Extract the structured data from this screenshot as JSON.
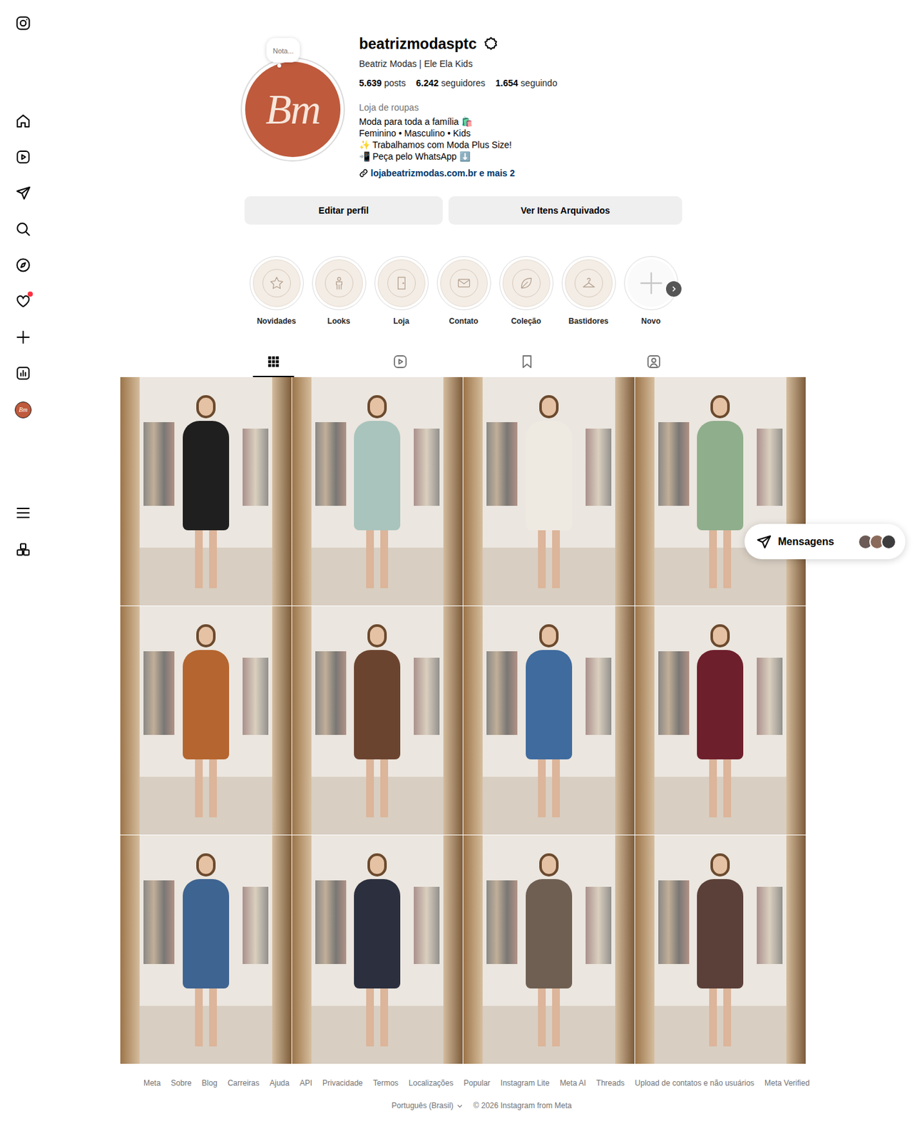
{
  "sidebar": {
    "notifications_dot": true,
    "avatar_text": "Bm"
  },
  "profile": {
    "username": "beatrizmodasptc",
    "full_name": "Beatriz Modas | Ele Ela Kids",
    "note": "Nota...",
    "avatar_text": "Bm",
    "stats": [
      {
        "value": "5.639",
        "label": "posts"
      },
      {
        "value": "6.242",
        "label": "seguidores"
      },
      {
        "value": "1.654",
        "label": "seguindo"
      }
    ],
    "category": "Loja de roupas",
    "bio": [
      "Moda para toda a família 🛍️",
      "Feminino • Masculino • Kids",
      "✨ Trabalhamos com Moda Plus Size!",
      "📲 Peça pelo WhatsApp ⬇️"
    ],
    "link": "lojabeatrizmodas.com.br e mais 2"
  },
  "buttons": [
    {
      "label": "Editar perfil"
    },
    {
      "label": "Ver Itens Arquivados"
    }
  ],
  "highlights": [
    {
      "label": "Novidades",
      "kind": "star"
    },
    {
      "label": "Looks",
      "kind": "figure"
    },
    {
      "label": "Loja",
      "kind": "door"
    },
    {
      "label": "Contato",
      "kind": "mail"
    },
    {
      "label": "Coleção",
      "kind": "leaf"
    },
    {
      "label": "Bastidores",
      "kind": "hanger"
    },
    {
      "label": "Novo",
      "kind": "new"
    }
  ],
  "tabs": [
    {
      "kind": "posts",
      "selected": true
    },
    {
      "kind": "reels",
      "selected": false
    },
    {
      "kind": "saved",
      "selected": false
    },
    {
      "kind": "tagged",
      "selected": false
    }
  ],
  "posts": [
    {
      "color": "#1f1f1f"
    },
    {
      "color": "#a9c4bd"
    },
    {
      "color": "#eeeae2"
    },
    {
      "color": "#8fae8c"
    },
    {
      "color": "#b5652f"
    },
    {
      "color": "#6b4430"
    },
    {
      "color": "#3f6b9e"
    },
    {
      "color": "#6e1f2c"
    },
    {
      "color": "#3e6491"
    },
    {
      "color": "#2b2f3e"
    },
    {
      "color": "#6f5f52"
    },
    {
      "color": "#5a4038"
    }
  ],
  "messages": {
    "label": "Mensagens",
    "avatars": [
      {
        "color": "#6b5a55"
      },
      {
        "color": "#8a6a5a"
      },
      {
        "color": "#3d3d3d"
      }
    ]
  },
  "footer": {
    "links": [
      "Meta",
      "Sobre",
      "Blog",
      "Carreiras",
      "Ajuda",
      "API",
      "Privacidade",
      "Termos",
      "Localizações",
      "Popular",
      "Instagram Lite",
      "Meta AI",
      "Threads",
      "Upload de contatos e não usuários",
      "Meta Verified"
    ],
    "language": "Português (Brasil)",
    "copyright": "© 2026 Instagram from Meta"
  }
}
